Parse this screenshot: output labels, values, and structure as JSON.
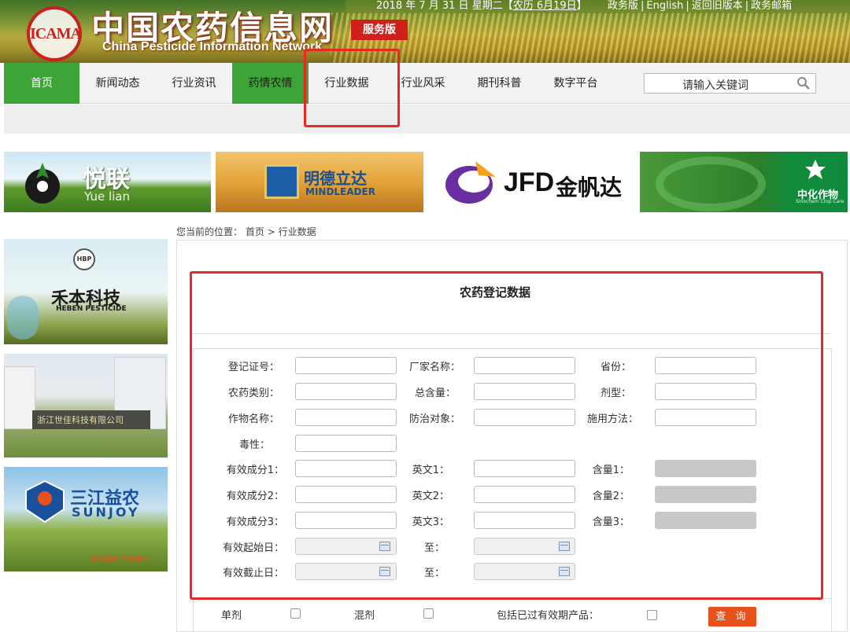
{
  "header": {
    "logo_text": "ICAMA",
    "site_title": "中国农药信息网",
    "site_subtitle": "China Pesticide Information Network",
    "edition_badge": "服务版",
    "date": "2018 年 7 月 31 日 星期二【",
    "lunar": "农历 6月19日",
    "date_close": "】",
    "links": [
      "政务版",
      "English",
      "返回旧版本",
      "政务邮箱"
    ]
  },
  "nav": {
    "items": [
      {
        "label": "首页"
      },
      {
        "label": "新闻动态"
      },
      {
        "label": "行业资讯"
      },
      {
        "label": "药情农情"
      },
      {
        "label": "行业数据"
      },
      {
        "label": "行业风采"
      },
      {
        "label": "期刊科普"
      },
      {
        "label": "数字平台"
      }
    ],
    "search_placeholder": "请输入关键词"
  },
  "banner_ads": {
    "ad1": {
      "cn": "悦联",
      "en": "Yue lian"
    },
    "ad2": {
      "cn": "明德立达",
      "en": "MINDLEADER"
    },
    "ad3": {
      "brand": "JFD",
      "cn": "金帆达"
    },
    "ad4": {
      "cn": "中化作物",
      "en": "Sinochem Crop Care"
    }
  },
  "side_ads": {
    "ad1": {
      "logo": "HBP",
      "cn": "禾本科技",
      "en": "HEBEN PESTICIDE"
    },
    "ad2": {
      "cn": "浙江世佳科技有限公司"
    },
    "ad3": {
      "cn": "三江益农",
      "en": "SUNJOY",
      "tagline": "承载信赖  共创未来"
    }
  },
  "breadcrumb": {
    "prefix": "您当前的位置：",
    "home": "首页",
    "sep": ">",
    "current": "行业数据"
  },
  "form": {
    "title": "农药登记数据",
    "labels": {
      "reg_no": "登记证号：",
      "maker": "厂家名称：",
      "province": "省份：",
      "category": "农药类别：",
      "total_content": "总含量：",
      "formulation": "剂型：",
      "crop": "作物名称：",
      "target": "防治对象：",
      "method": "施用方法：",
      "toxicity": "毒性：",
      "ingredient1": "有效成分1：",
      "english1": "英文1：",
      "content1": "含量1：",
      "ingredient2": "有效成分2：",
      "english2": "英文2：",
      "content2": "含量2：",
      "ingredient3": "有效成分3：",
      "english3": "英文3：",
      "content3": "含量3：",
      "valid_start": "有效起始日：",
      "to1": "至：",
      "valid_end": "有效截止日：",
      "to2": "至："
    },
    "options": {
      "single": "单剂",
      "mixed": "混剂",
      "include_expired": "包括已过有效期产品："
    },
    "query_button": "查 询"
  },
  "colors": {
    "nav_green": "#3da538",
    "highlight_red": "#e52a26",
    "query_button": "#e8501c",
    "badge_red": "#d0201c"
  }
}
